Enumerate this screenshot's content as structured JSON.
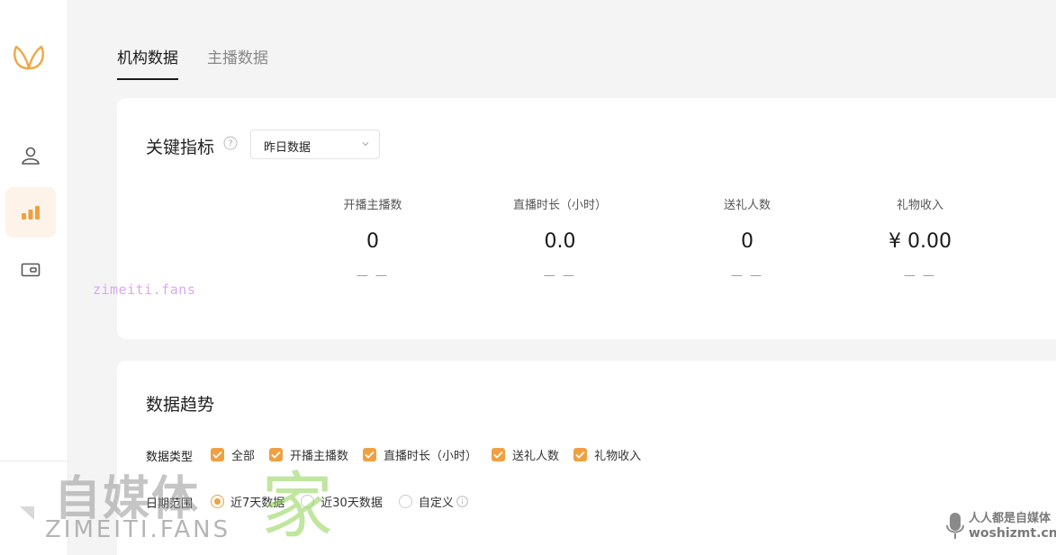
{
  "tabs": [
    {
      "label": "机构数据",
      "active": true
    },
    {
      "label": "主播数据",
      "active": false
    }
  ],
  "metrics_card": {
    "title": "关键指标",
    "select_value": "昨日数据",
    "metrics": [
      {
        "label": "开播主播数",
        "value": "0",
        "delta": "— —"
      },
      {
        "label": "直播时长（小时）",
        "value": "0.0",
        "delta": "— —"
      },
      {
        "label": "送礼人数",
        "value": "0",
        "delta": "— —"
      },
      {
        "label": "礼物收入",
        "value": "¥ 0.00",
        "delta": "— —"
      }
    ]
  },
  "trend_card": {
    "title": "数据趋势",
    "type_label": "数据类型",
    "types": [
      {
        "label": "全部",
        "checked": true
      },
      {
        "label": "开播主播数",
        "checked": true
      },
      {
        "label": "直播时长（小时）",
        "checked": true
      },
      {
        "label": "送礼人数",
        "checked": true
      },
      {
        "label": "礼物收入",
        "checked": true
      }
    ],
    "range_label": "日期范围",
    "ranges": [
      {
        "label": "近7天数据",
        "selected": true
      },
      {
        "label": "近30天数据",
        "selected": false
      },
      {
        "label": "自定义",
        "selected": false
      }
    ]
  },
  "watermarks": {
    "small": "zimeiti.fans",
    "big_cn": "自媒体",
    "big_jia": "家",
    "big_en": "ZIMEITI.FANS",
    "corner_cn": "人人都是自媒体",
    "corner_en": "woshizmt.cn"
  },
  "colors": {
    "accent": "#f0a040",
    "active_nav_bg": "#fdf3e8"
  }
}
